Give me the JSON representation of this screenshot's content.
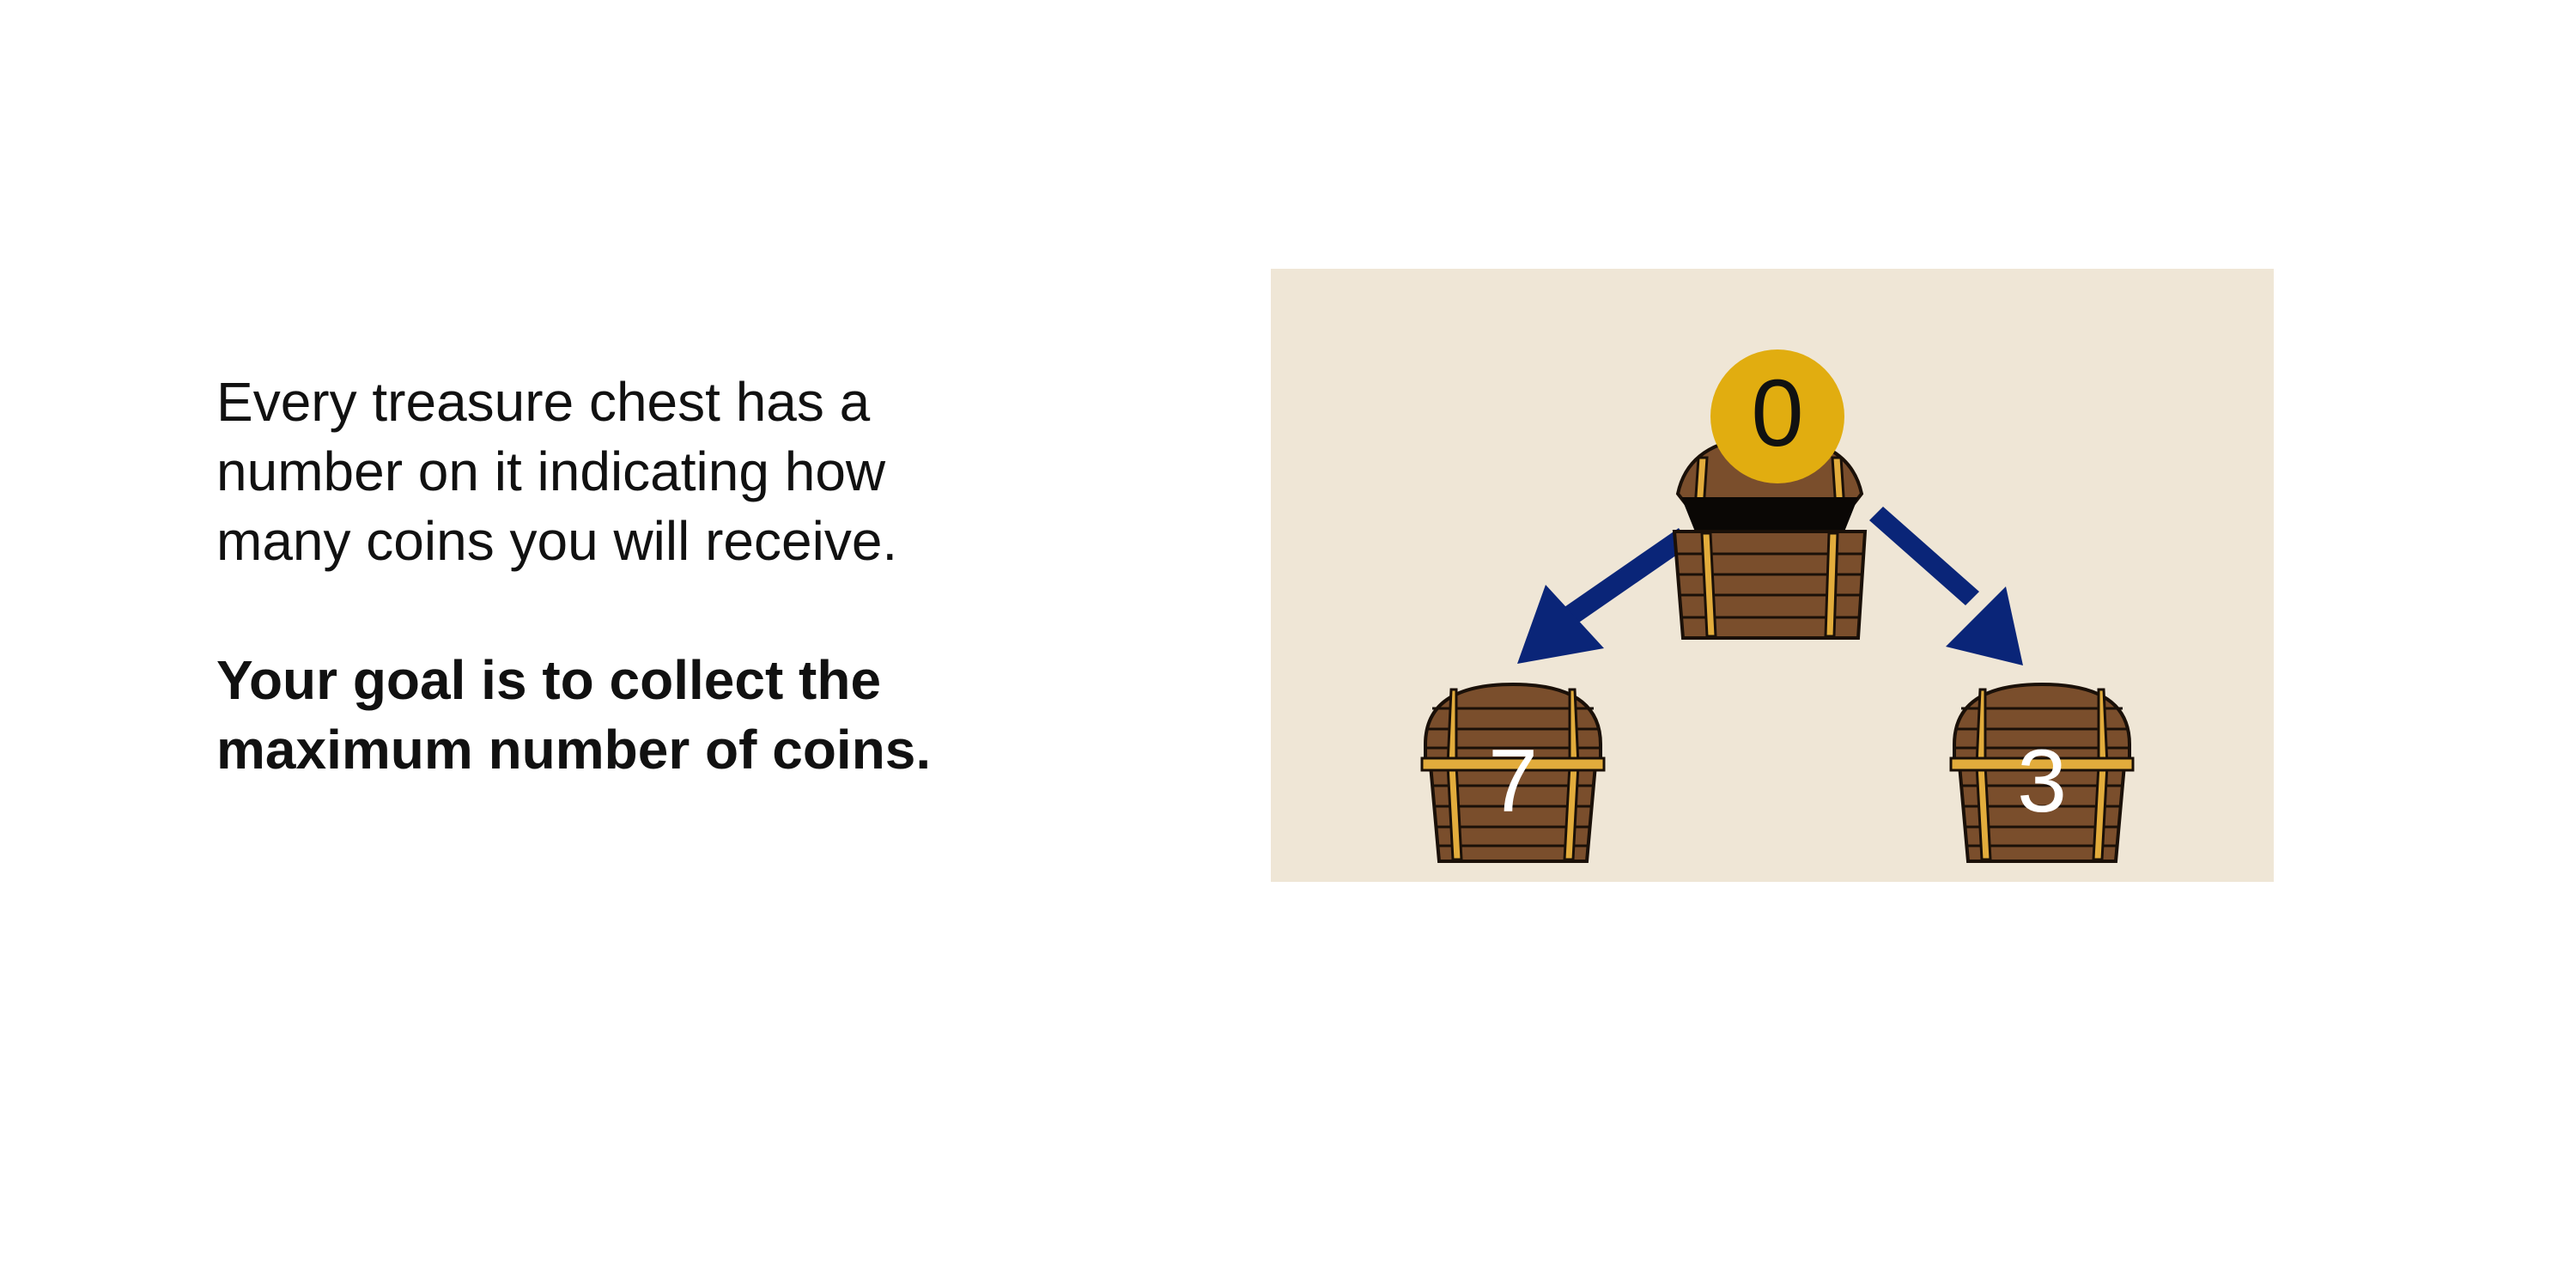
{
  "instructions": {
    "line1": "Every treasure chest has a",
    "line2": "number on it indicating how",
    "line3": "many coins you will receive.",
    "goal_line1": "Your goal is to collect the",
    "goal_line2": "maximum number of coins."
  },
  "chests": {
    "start": {
      "value": "0",
      "state": "open"
    },
    "left": {
      "value": "7",
      "state": "closed"
    },
    "right": {
      "value": "3",
      "state": "closed"
    }
  },
  "colors": {
    "scene_background": "#efe6d6",
    "arrow": "#0a2578",
    "coin": "#e1ad10",
    "wood": "#7a4e2c",
    "band": "#e2ac3c"
  },
  "icons": [
    "treasure-chest-icon",
    "coin-icon",
    "arrow-icon"
  ]
}
